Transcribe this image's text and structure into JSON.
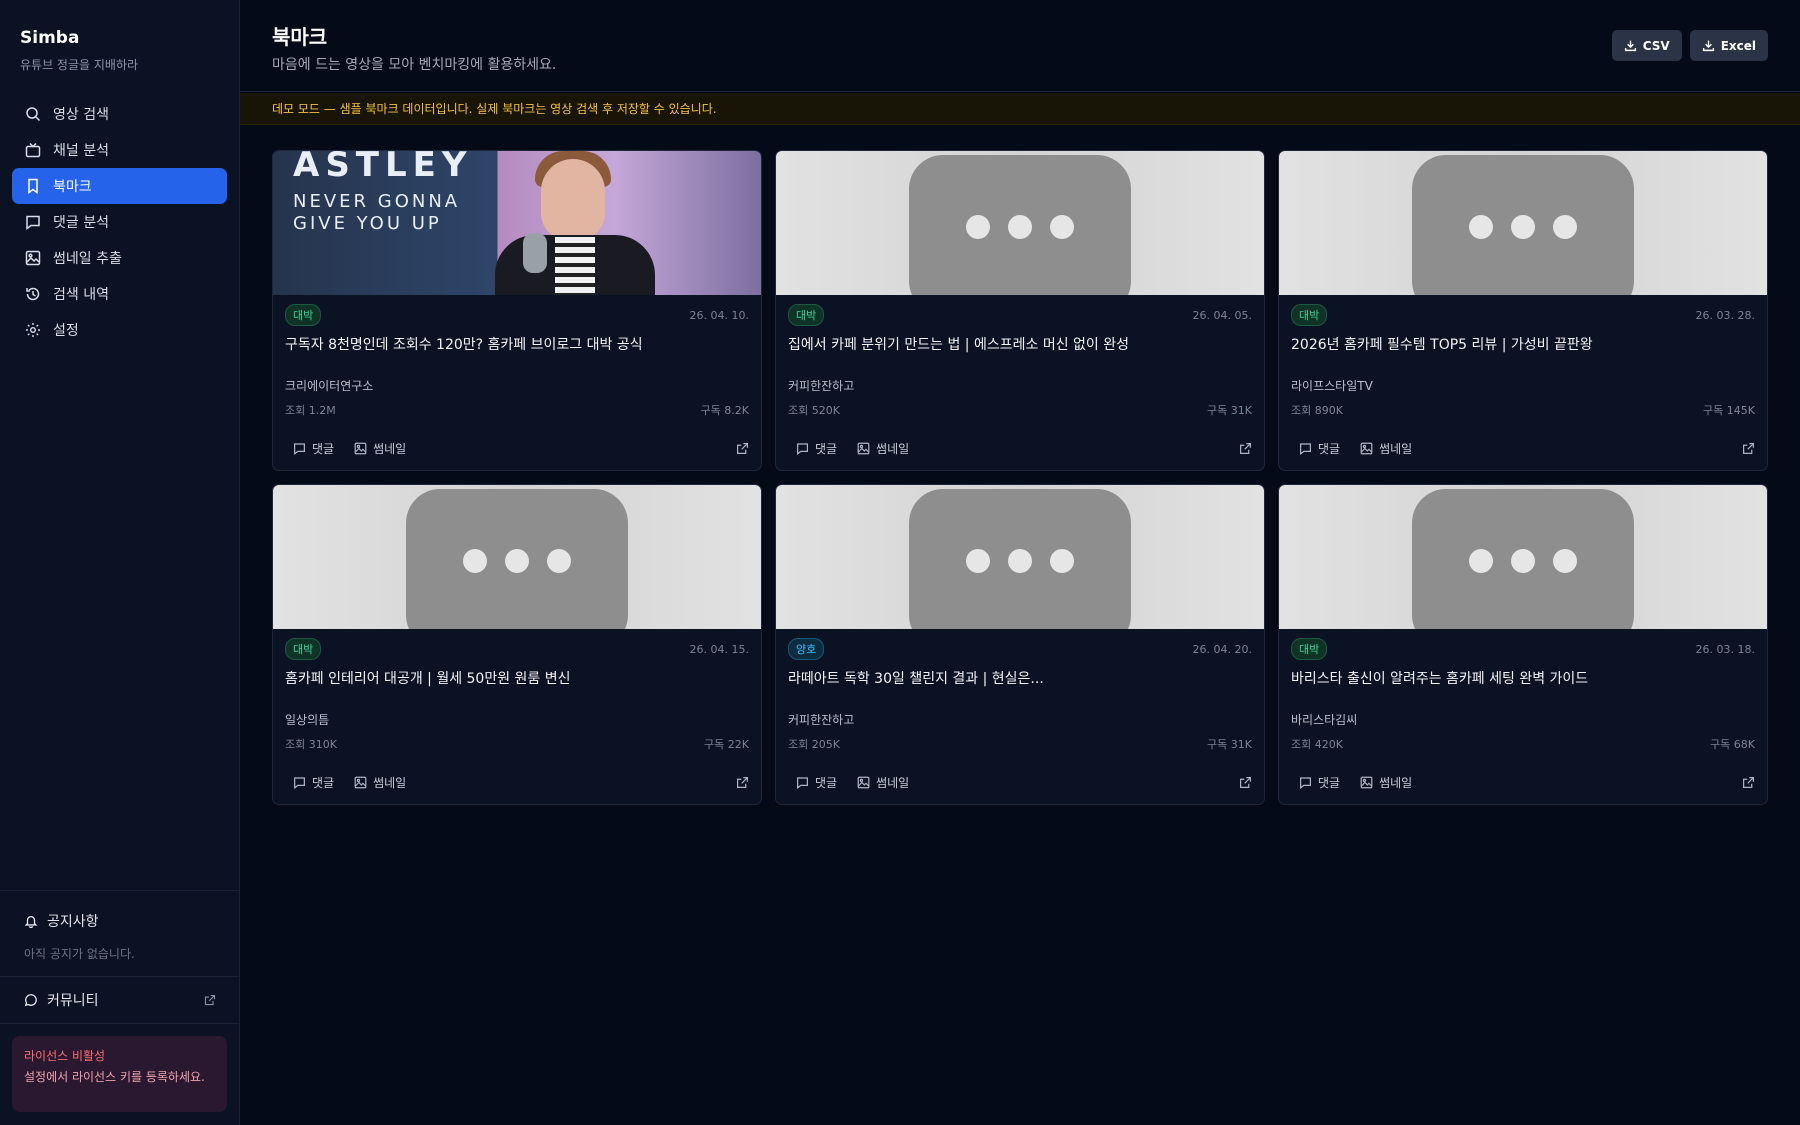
{
  "app": {
    "name": "Simba",
    "tagline": "유튜브 정글을 지배하라"
  },
  "nav": [
    {
      "label": "영상 검색",
      "icon": "search-icon",
      "active": false
    },
    {
      "label": "채널 분석",
      "icon": "tv-icon",
      "active": false
    },
    {
      "label": "북마크",
      "icon": "bookmark-icon",
      "active": true
    },
    {
      "label": "댓글 분석",
      "icon": "comment-icon",
      "active": false
    },
    {
      "label": "썸네일 추출",
      "icon": "image-icon",
      "active": false
    },
    {
      "label": "검색 내역",
      "icon": "history-icon",
      "active": false
    },
    {
      "label": "설정",
      "icon": "gear-icon",
      "active": false
    }
  ],
  "notice": {
    "title": "공지사항",
    "empty": "아직 공지가 없습니다."
  },
  "community": {
    "label": "커뮤니티"
  },
  "license": {
    "title": "라이선스 비활성",
    "desc": "설정에서 라이선스 키를 등록하세요."
  },
  "header": {
    "title": "북마크",
    "subtitle": "마음에 드는 영상을 모아 벤치마킹에 활용하세요.",
    "csv_label": "CSV",
    "excel_label": "Excel"
  },
  "banner": {
    "text": "데모 모드 — 샘플 북마크 데이터입니다. 실제 북마크는 영상 검색 후 저장할 수 있습니다."
  },
  "actions": {
    "comments": "댓글",
    "thumbnail": "썸네일"
  },
  "cards": [
    {
      "badge": "대박",
      "badge_type": "hit",
      "date": "26. 04. 10.",
      "title": "구독자 8천명인데 조회수 120만? 홈카페 브이로그 대박 공식",
      "channel": "크리에이터연구소",
      "views": "조회 1.2M",
      "subs": "구독 8.2K",
      "thumb": "rick",
      "thumb_text": {
        "big": "ASTLEY",
        "line1": "NEVER GONNA",
        "line2": "GIVE YOU UP"
      }
    },
    {
      "badge": "대박",
      "badge_type": "hit",
      "date": "26. 04. 05.",
      "title": "집에서 카페 분위기 만드는 법 | 에스프레소 머신 없이 완성",
      "channel": "커피한잔하고",
      "views": "조회 520K",
      "subs": "구독 31K",
      "thumb": "placeholder"
    },
    {
      "badge": "대박",
      "badge_type": "hit",
      "date": "26. 03. 28.",
      "title": "2026년 홈카페 필수템 TOP5 리뷰 | 가성비 끝판왕",
      "channel": "라이프스타일TV",
      "views": "조회 890K",
      "subs": "구독 145K",
      "thumb": "placeholder"
    },
    {
      "badge": "대박",
      "badge_type": "hit",
      "date": "26. 04. 15.",
      "title": "홈카페 인테리어 대공개 | 월세 50만원 원룸 변신",
      "channel": "일상의틈",
      "views": "조회 310K",
      "subs": "구독 22K",
      "thumb": "placeholder"
    },
    {
      "badge": "양호",
      "badge_type": "good",
      "date": "26. 04. 20.",
      "title": "라떼아트 독학 30일 챌린지 결과 | 현실은...",
      "channel": "커피한잔하고",
      "views": "조회 205K",
      "subs": "구독 31K",
      "thumb": "placeholder"
    },
    {
      "badge": "대박",
      "badge_type": "hit",
      "date": "26. 03. 18.",
      "title": "바리스타 출신이 알려주는 홈카페 세팅 완벽 가이드",
      "channel": "바리스타김씨",
      "views": "조회 420K",
      "subs": "구독 68K",
      "thumb": "placeholder"
    }
  ]
}
